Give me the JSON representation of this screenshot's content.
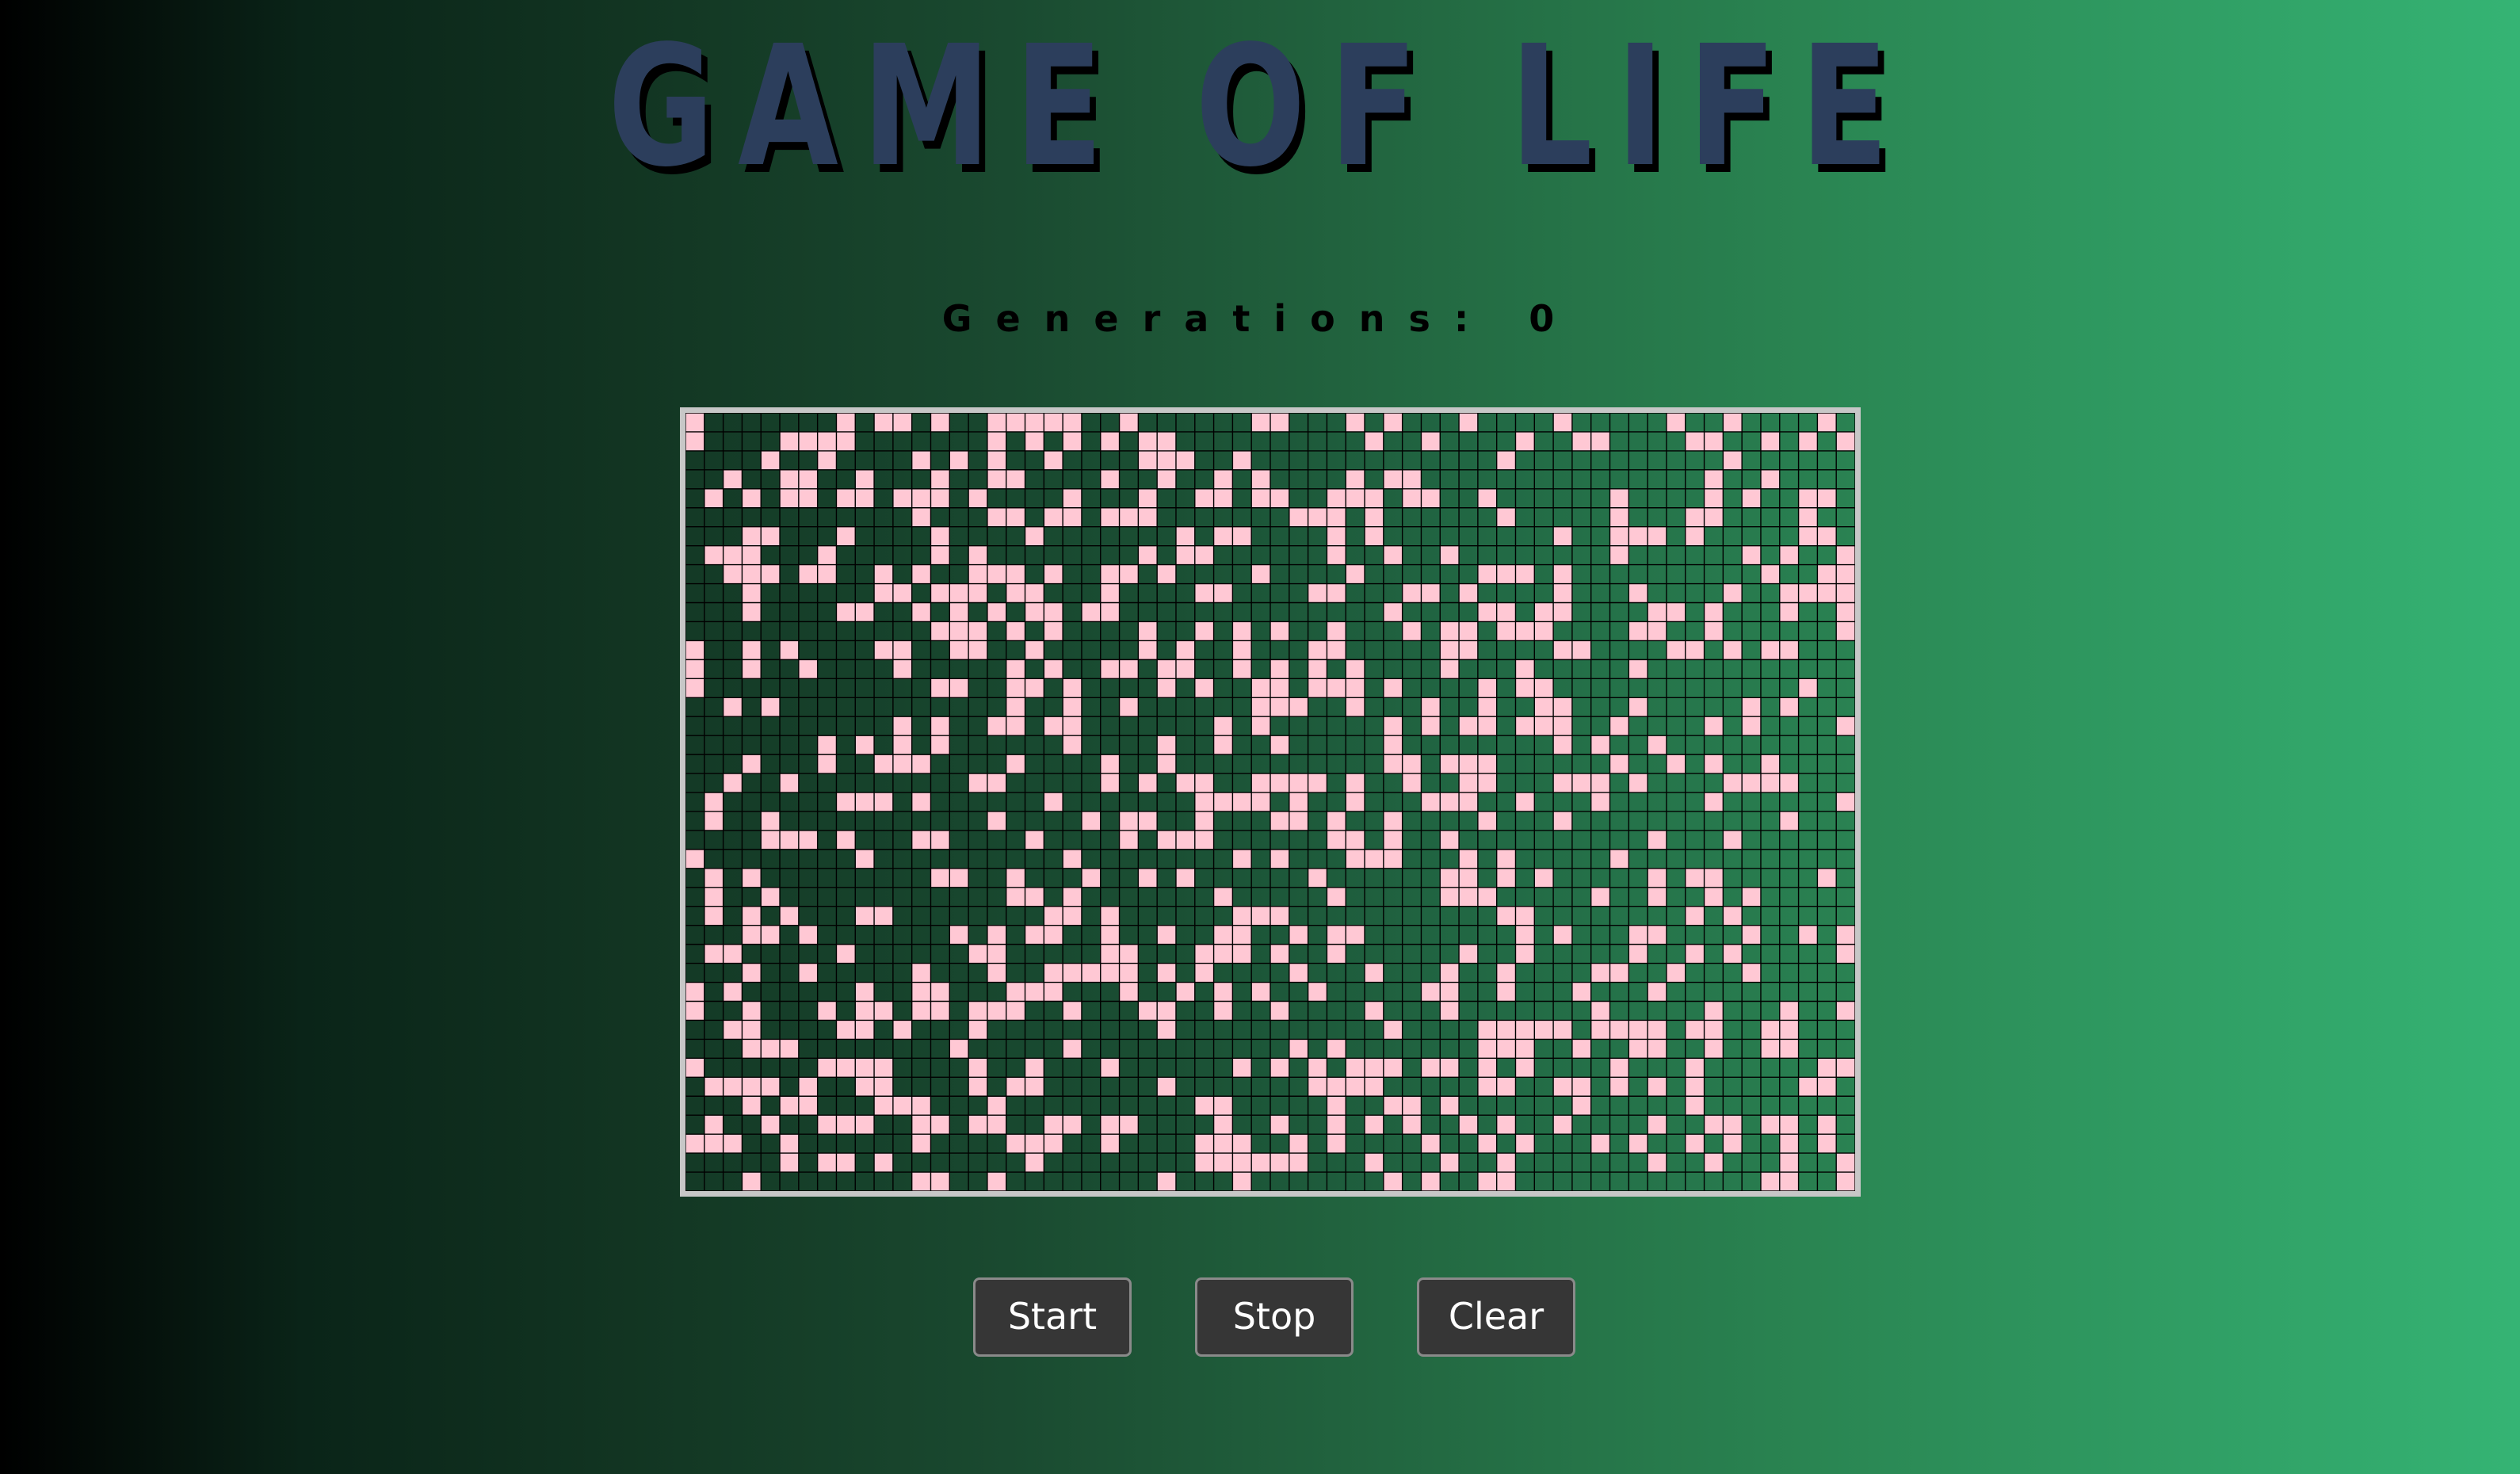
{
  "title": "GAME OF LIFE",
  "generations": {
    "label": "Generations:",
    "value": "0"
  },
  "board": {
    "columns": 62,
    "rows": 41,
    "live_color": "#ffc8d4",
    "grid_line_color": "#000000",
    "border_color": "#c7c7c7"
  },
  "buttons": {
    "start": "Start",
    "stop": "Stop",
    "clear": "Clear"
  }
}
